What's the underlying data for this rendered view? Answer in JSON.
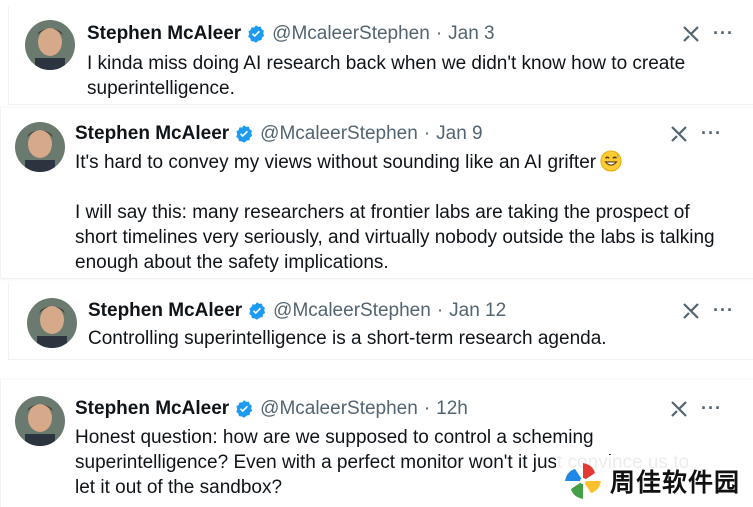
{
  "tweets": [
    {
      "name": "Stephen McAleer",
      "handle": "@McaleerStephen",
      "separator": "·",
      "time": "Jan 3",
      "text": "I kinda miss doing AI research back when we didn't know how to create superintelligence.",
      "more": "···",
      "action_icon": "grok-icon",
      "verified_icon": "verified-badge-icon"
    },
    {
      "name": "Stephen McAleer",
      "handle": "@McaleerStephen",
      "separator": "·",
      "time": "Jan 9",
      "text_line1": "It's hard to convey my views without sounding like an AI grifter",
      "emoji": "grinning-face-with-sweat-emoji",
      "text_para2": "I will say this: many researchers at frontier labs are taking the prospect of short timelines very seriously, and virtually nobody outside the labs is talking enough about the safety implications.",
      "more": "···",
      "action_icon": "grok-icon",
      "verified_icon": "verified-badge-icon"
    },
    {
      "name": "Stephen McAleer",
      "handle": "@McaleerStephen",
      "separator": "·",
      "time": "Jan 12",
      "text": "Controlling superintelligence is a short-term research agenda.",
      "more": "···",
      "action_icon": "grok-icon",
      "verified_icon": "verified-badge-icon"
    },
    {
      "name": "Stephen McAleer",
      "handle": "@McaleerStephen",
      "separator": "·",
      "time": "12h",
      "text": "Honest question: how are we supposed to control a scheming superintelligence? Even with a perfect monitor won't it just convince us to let it out of the sandbox?",
      "more": "···",
      "action_icon": "grok-icon",
      "verified_icon": "verified-badge-icon"
    }
  ],
  "watermark": {
    "text": "周佳软件园"
  },
  "colors": {
    "verified": "#1d9bf0",
    "secondary_text": "#536471",
    "primary_text": "#0f1419"
  }
}
